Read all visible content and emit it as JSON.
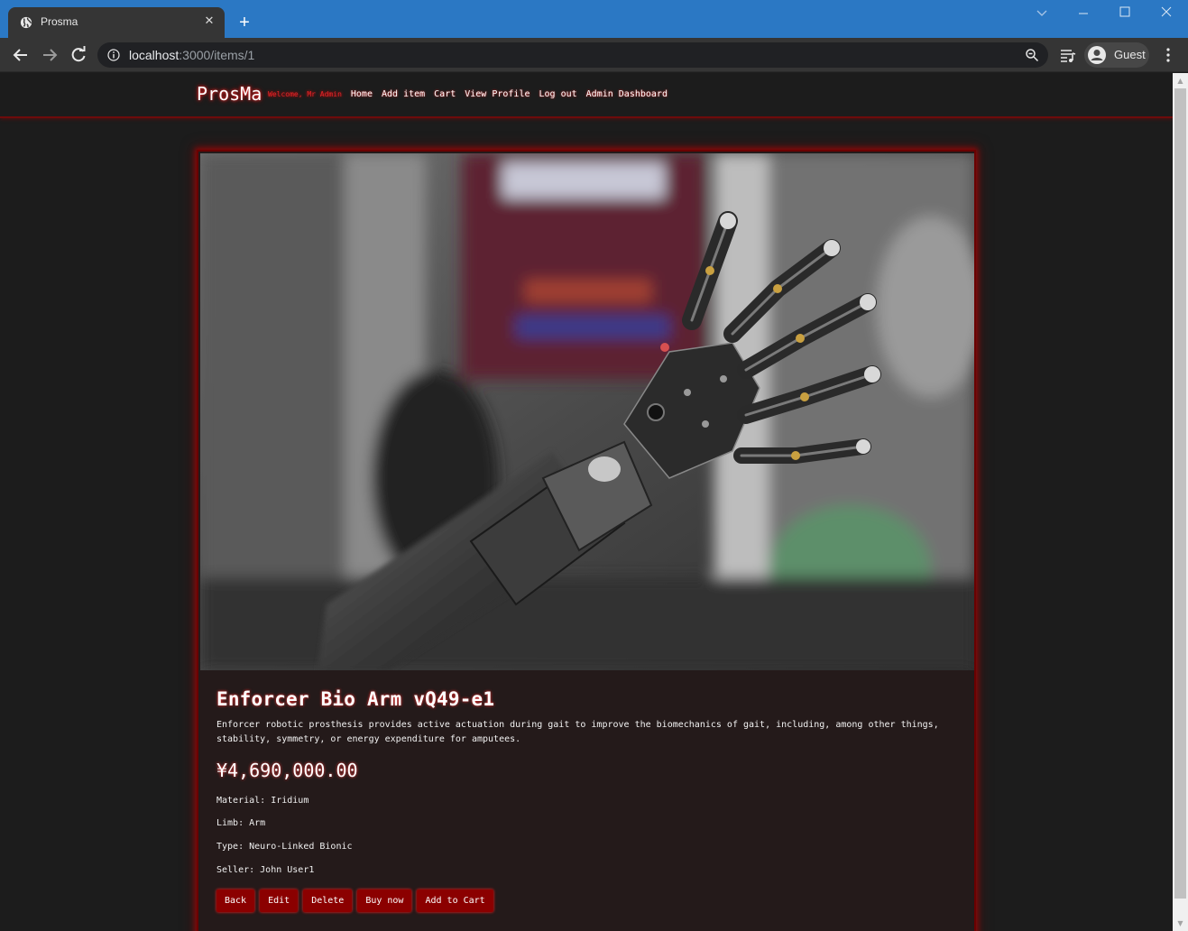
{
  "browser": {
    "tab_title": "Prosma",
    "url_host": "localhost",
    "url_path": ":3000/items/1",
    "profile_name": "Guest"
  },
  "site": {
    "brand": "ProsMa",
    "welcome": "Welcome, Mr Admin",
    "nav": [
      "Home",
      "Add item",
      "Cart",
      "View Profile",
      "Log out",
      "Admin Dashboard"
    ]
  },
  "item": {
    "image_alt": "Bionic prosthetic arm",
    "title": "Enforcer Bio Arm vQ49-e1",
    "description": "Enforcer robotic prosthesis provides active actuation during gait to improve the biomechanics of gait, including, among other things, stability, symmetry, or energy expenditure for amputees.",
    "price": "¥4,690,000.00",
    "specs": {
      "material": "Material: Iridium",
      "limb": "Limb: Arm",
      "type": "Type: Neuro-Linked Bionic",
      "seller": "Seller: John User1"
    },
    "actions": {
      "back": "Back",
      "edit": "Edit",
      "delete": "Delete",
      "buy": "Buy now",
      "cart": "Add to Cart"
    }
  },
  "theme": {
    "accent": "#8b0000",
    "glow": "#ff2020",
    "background": "#1c1c1c"
  }
}
